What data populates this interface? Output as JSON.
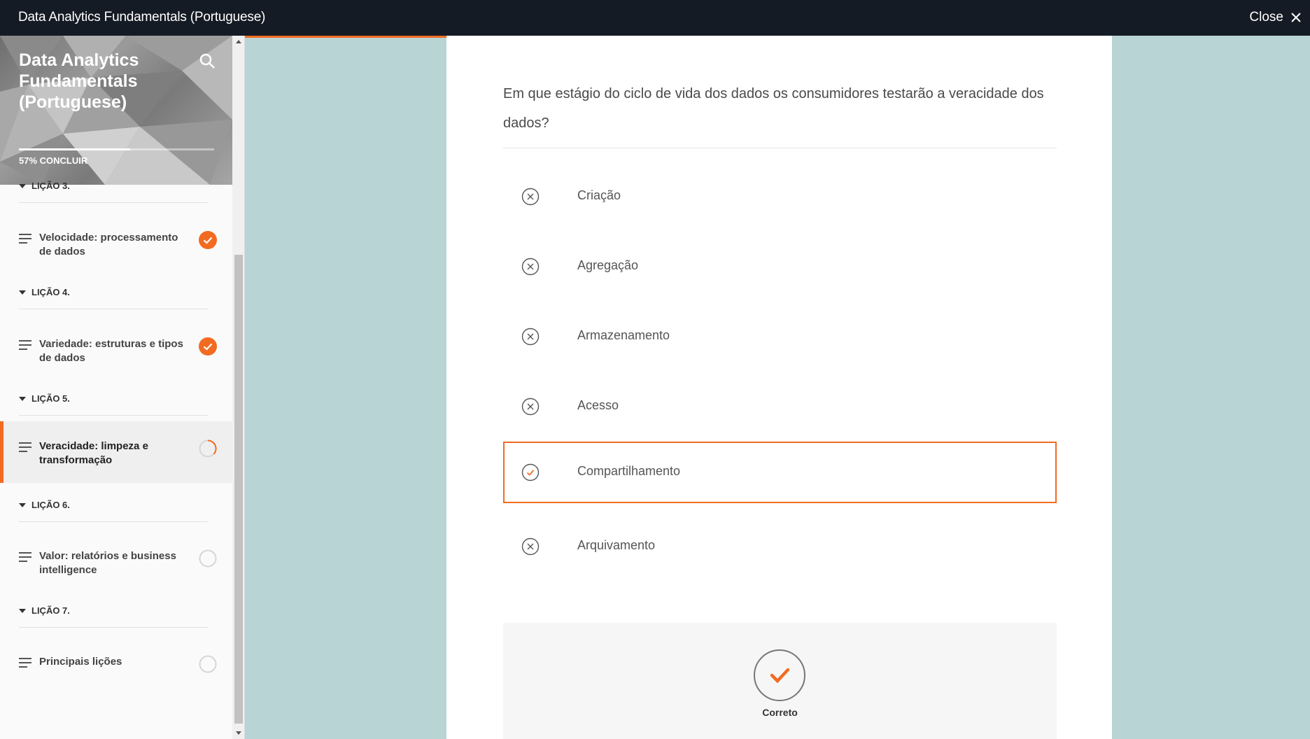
{
  "window": {
    "title": "Data Analytics Fundamentals (Portuguese)",
    "close_label": "Close"
  },
  "sidebar": {
    "course_title": "Data Analytics Fundamentals (Portuguese)",
    "progress_label": "57% CONCLUIR",
    "progress_fraction": 0.57,
    "partial_section": "LIÇÃO 3.",
    "items": [
      {
        "label": "Velocidade: processamento de dados",
        "status": "complete"
      },
      {
        "section": "LIÇÃO 4."
      },
      {
        "label": "Variedade: estruturas e tipos de dados",
        "status": "complete"
      },
      {
        "section": "LIÇÃO 5."
      },
      {
        "label": "Veracidade: limpeza e transformação",
        "status": "in-progress",
        "active": true
      },
      {
        "section": "LIÇÃO 6."
      },
      {
        "label": "Valor: relatórios e business intelligence",
        "status": "not-started"
      },
      {
        "section": "LIÇÃO 7."
      },
      {
        "label": "Principais lições",
        "status": "not-started"
      }
    ]
  },
  "quiz": {
    "question": "Em que estágio do ciclo de vida dos dados os consumidores testarão a veracidade dos dados?",
    "options": [
      {
        "label": "Criação",
        "state": "incorrect"
      },
      {
        "label": "Agregação",
        "state": "incorrect"
      },
      {
        "label": "Armazenamento",
        "state": "incorrect"
      },
      {
        "label": "Acesso",
        "state": "incorrect"
      },
      {
        "label": "Compartilhamento",
        "state": "correct",
        "selected": true
      },
      {
        "label": "Arquivamento",
        "state": "incorrect"
      }
    ],
    "feedback": {
      "result": "Correto",
      "icon": "checkmark-icon"
    }
  },
  "colors": {
    "accent": "#f26b21",
    "topbar": "#151b24",
    "backdrop": "#b8d4d5"
  }
}
